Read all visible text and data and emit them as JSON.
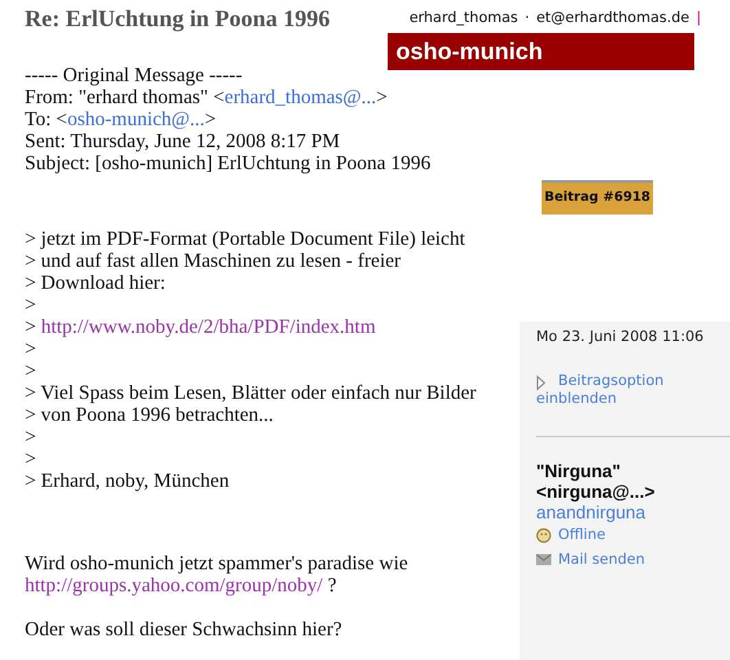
{
  "title": "Re: ErlUchtung in Poona 1996",
  "header": {
    "user": "erhard_thomas",
    "separator": "·",
    "email": "et@erhardthomas.de",
    "bar": "|",
    "group": "osho-munich"
  },
  "message_header": [
    {
      "prefix": "----- Original Message -----"
    },
    {
      "prefix": "From: \"erhard thomas\" <",
      "link": "erhard_thomas@...",
      "suffix": ">"
    },
    {
      "prefix": "To: <",
      "link": "osho-munich@...",
      "suffix": ">"
    },
    {
      "prefix": "Sent: Thursday, June 12, 2008 8:17 PM"
    },
    {
      "prefix": "Subject: [osho-munich] ErlUchtung in Poona 1996"
    }
  ],
  "badge": "Beitrag #6918",
  "quote": [
    {
      "prefix": "> jetzt im PDF-Format (Portable Document File) leicht"
    },
    {
      "prefix": "> und auf fast allen Maschinen zu lesen - freier"
    },
    {
      "prefix": "> Download hier:"
    },
    {
      "prefix": ">"
    },
    {
      "prefix": "> ",
      "link": "http://www.noby.de/2/bha/PDF/index.htm"
    },
    {
      "prefix": ">"
    },
    {
      "prefix": ">"
    },
    {
      "prefix": "> Viel Spass beim Lesen, Blätter oder einfach nur Bilder"
    },
    {
      "prefix": "> von Poona 1996 betrachten..."
    },
    {
      "prefix": ">"
    },
    {
      "prefix": ">"
    },
    {
      "prefix": "> Erhard, noby, München"
    }
  ],
  "reply": [
    [
      {
        "prefix": "Wird osho-munich jetzt spammer's paradise wie"
      },
      {
        "link": "http://groups.yahoo.com/group/noby/",
        "suffix": " ?"
      }
    ],
    [
      {
        "prefix": "Oder was soll dieser Schwachsinn hier?"
      }
    ]
  ],
  "sidebar": {
    "date": "Mo 23. Juni 2008 11:06",
    "options_link": "Beitragsoption einblenden",
    "author_name": "\"Nirguna\"",
    "author_email": "<nirguna@...>",
    "username": "anandnirguna",
    "status": "Offline",
    "mail": "Mail senden"
  }
}
